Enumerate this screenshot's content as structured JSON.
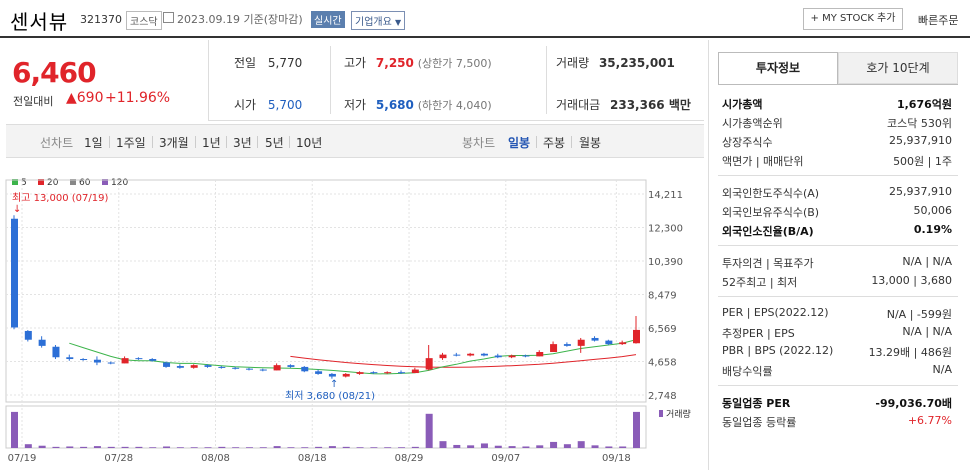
{
  "header": {
    "name": "센서뷰",
    "code": "321370",
    "market": "코스닥",
    "date": "2023.09.19 기준(장마감)",
    "realtime": "실시간",
    "corp_info": "기업개요",
    "mystock": "+ MY STOCK 추가",
    "quick_order": "빠른주문"
  },
  "price": {
    "current": "6,460",
    "change_label": "전일대비",
    "change": "▲690",
    "change_pct": "+11.96%"
  },
  "stats": {
    "prev_label": "전일",
    "prev": "5,770",
    "open_label": "시가",
    "open": "5,700",
    "high_label": "고가",
    "high": "7,250",
    "high_note": "(상한가 7,500)",
    "low_label": "저가",
    "low": "5,680",
    "low_note": "(하한가 4,040)",
    "volume_label": "거래량",
    "volume": "35,235,001",
    "amount_label": "거래대금",
    "amount": "233,366 백만"
  },
  "chart_tabs": {
    "line_chart": "선차트",
    "periods": [
      "1일",
      "1주일",
      "3개월",
      "1년",
      "3년",
      "5년",
      "10년"
    ],
    "candle_chart": "봉차트",
    "candles": [
      "일봉",
      "주봉",
      "월봉"
    ]
  },
  "legend": {
    "ma5": "5",
    "ma20": "20",
    "ma60": "60",
    "ma120": "120",
    "ma5_color": "#3cb44b",
    "ma20_color": "#e0242a",
    "ma60_color": "#888888",
    "ma120_color": "#8a5cb8",
    "volume": "거래량"
  },
  "annotations": {
    "high": "최고 13,000 (07/19)",
    "low": "최저 3,680 (08/21)"
  },
  "chart_data": {
    "type": "candlestick",
    "y_ticks": [
      "14,211",
      "12,300",
      "10,390",
      "8,479",
      "6,569",
      "4,658",
      "2,748"
    ],
    "x_ticks": [
      "07/19",
      "07/28",
      "08/08",
      "08/18",
      "08/29",
      "09/07",
      "09/18"
    ],
    "ylim": [
      2748,
      14211
    ],
    "candles": [
      {
        "o": 12800,
        "h": 13000,
        "l": 6500,
        "c": 6600
      },
      {
        "o": 6400,
        "h": 6450,
        "l": 5800,
        "c": 5900
      },
      {
        "o": 5900,
        "h": 6100,
        "l": 5450,
        "c": 5550
      },
      {
        "o": 5500,
        "h": 5600,
        "l": 4800,
        "c": 4900
      },
      {
        "o": 4900,
        "h": 5050,
        "l": 4700,
        "c": 4800
      },
      {
        "o": 4800,
        "h": 4850,
        "l": 4700,
        "c": 4760
      },
      {
        "o": 4760,
        "h": 4950,
        "l": 4450,
        "c": 4600
      },
      {
        "o": 4600,
        "h": 4650,
        "l": 4500,
        "c": 4550
      },
      {
        "o": 4550,
        "h": 4950,
        "l": 4550,
        "c": 4850
      },
      {
        "o": 4850,
        "h": 4900,
        "l": 4750,
        "c": 4800
      },
      {
        "o": 4800,
        "h": 4850,
        "l": 4650,
        "c": 4700
      },
      {
        "o": 4600,
        "h": 4650,
        "l": 4300,
        "c": 4350
      },
      {
        "o": 4400,
        "h": 4500,
        "l": 4250,
        "c": 4300
      },
      {
        "o": 4300,
        "h": 4500,
        "l": 4250,
        "c": 4450
      },
      {
        "o": 4450,
        "h": 4500,
        "l": 4300,
        "c": 4350
      },
      {
        "o": 4350,
        "h": 4400,
        "l": 4250,
        "c": 4300
      },
      {
        "o": 4300,
        "h": 4350,
        "l": 4200,
        "c": 4250
      },
      {
        "o": 4250,
        "h": 4300,
        "l": 4150,
        "c": 4200
      },
      {
        "o": 4200,
        "h": 4250,
        "l": 4100,
        "c": 4150
      },
      {
        "o": 4150,
        "h": 4550,
        "l": 4150,
        "c": 4450
      },
      {
        "o": 4450,
        "h": 4500,
        "l": 4300,
        "c": 4350
      },
      {
        "o": 4350,
        "h": 4400,
        "l": 4050,
        "c": 4100
      },
      {
        "o": 4100,
        "h": 4200,
        "l": 3900,
        "c": 3950
      },
      {
        "o": 3950,
        "h": 4000,
        "l": 3680,
        "c": 3800
      },
      {
        "o": 3800,
        "h": 4000,
        "l": 3750,
        "c": 3950
      },
      {
        "o": 3950,
        "h": 4100,
        "l": 3900,
        "c": 4050
      },
      {
        "o": 4050,
        "h": 4100,
        "l": 3950,
        "c": 4000
      },
      {
        "o": 4000,
        "h": 4100,
        "l": 3950,
        "c": 4050
      },
      {
        "o": 4050,
        "h": 4150,
        "l": 3950,
        "c": 4000
      },
      {
        "o": 4000,
        "h": 4300,
        "l": 4000,
        "c": 4200
      },
      {
        "o": 4200,
        "h": 5600,
        "l": 4150,
        "c": 4850
      },
      {
        "o": 4850,
        "h": 5150,
        "l": 4750,
        "c": 5050
      },
      {
        "o": 5050,
        "h": 5150,
        "l": 4950,
        "c": 5000
      },
      {
        "o": 5000,
        "h": 5150,
        "l": 4950,
        "c": 5100
      },
      {
        "o": 5100,
        "h": 5150,
        "l": 4950,
        "c": 5000
      },
      {
        "o": 5000,
        "h": 5100,
        "l": 4850,
        "c": 4900
      },
      {
        "o": 4900,
        "h": 5050,
        "l": 4850,
        "c": 5000
      },
      {
        "o": 5000,
        "h": 5050,
        "l": 4900,
        "c": 4950
      },
      {
        "o": 4950,
        "h": 5300,
        "l": 4950,
        "c": 5200
      },
      {
        "o": 5200,
        "h": 5800,
        "l": 5200,
        "c": 5650
      },
      {
        "o": 5650,
        "h": 5750,
        "l": 5500,
        "c": 5550
      },
      {
        "o": 5550,
        "h": 6000,
        "l": 5150,
        "c": 5900
      },
      {
        "o": 6000,
        "h": 6100,
        "l": 5800,
        "c": 5850
      },
      {
        "o": 5850,
        "h": 5900,
        "l": 5600,
        "c": 5650
      },
      {
        "o": 5650,
        "h": 5850,
        "l": 5600,
        "c": 5750
      },
      {
        "o": 5700,
        "h": 7250,
        "l": 5680,
        "c": 6460
      }
    ],
    "ma5": [
      null,
      null,
      null,
      null,
      5700,
      5450,
      5200,
      4950,
      4750,
      4700,
      4700,
      4600,
      4550,
      4550,
      4480,
      4420,
      4360,
      4330,
      4300,
      4290,
      4270,
      4240,
      4200,
      4150,
      4090,
      4020,
      3960,
      3950,
      3980,
      4020,
      4150,
      4350,
      4500,
      4680,
      4800,
      4950,
      5000,
      5000,
      5020,
      5100,
      5250,
      5400,
      5500,
      5600,
      5700,
      5900
    ],
    "ma20": [
      null,
      null,
      null,
      null,
      null,
      null,
      null,
      null,
      null,
      null,
      null,
      null,
      null,
      null,
      null,
      null,
      null,
      null,
      null,
      null,
      4950,
      4850,
      4760,
      4680,
      4600,
      4540,
      4480,
      4430,
      4390,
      4360,
      4340,
      4330,
      4330,
      4340,
      4360,
      4390,
      4420,
      4460,
      4500,
      4560,
      4630,
      4700,
      4780,
      4850,
      4940,
      5050
    ],
    "volume": [
      95,
      10,
      6,
      3,
      4,
      3,
      5,
      3,
      3,
      3,
      2,
      4,
      2,
      2,
      2,
      3,
      2,
      2,
      2,
      5,
      2,
      2,
      3,
      5,
      3,
      2,
      2,
      2,
      2,
      3,
      90,
      18,
      8,
      7,
      12,
      6,
      5,
      4,
      7,
      16,
      10,
      18,
      7,
      4,
      4,
      95
    ]
  },
  "right_panel": {
    "tab_on": "투자정보",
    "tab_off": "호가 10단계",
    "rows1": [
      {
        "k": "시가총액",
        "v": "1,676억원",
        "bold": true
      },
      {
        "k": "시가총액순위",
        "v": "코스닥 530위"
      },
      {
        "k": "상장주식수",
        "v": "25,937,910"
      },
      {
        "k": "액면가 | 매매단위",
        "v": "500원 | 1주"
      }
    ],
    "rows2": [
      {
        "k": "외국인한도주식수(A)",
        "v": "25,937,910"
      },
      {
        "k": "외국인보유주식수(B)",
        "v": "50,006"
      },
      {
        "k": "외국인소진율(B/A)",
        "v": "0.19%",
        "bold": true
      }
    ],
    "rows3": [
      {
        "k": "투자의견 | 목표주가",
        "v": "N/A | N/A"
      },
      {
        "k": "52주최고 | 최저",
        "v": "13,000 | 3,680"
      }
    ],
    "rows4": [
      {
        "k": "PER | EPS(2022.12)",
        "v": "N/A | -599원"
      },
      {
        "k": "추정PER | EPS",
        "v": "N/A | N/A"
      },
      {
        "k": "PBR | BPS (2022.12)",
        "v": "13.29배 | 486원"
      },
      {
        "k": "배당수익률",
        "v": "N/A"
      }
    ],
    "rows5": [
      {
        "k": "동일업종 PER",
        "v": "-99,036.70배",
        "bold": true
      },
      {
        "k": "동일업종 등락률",
        "v": "+6.77%",
        "red": true
      }
    ]
  }
}
